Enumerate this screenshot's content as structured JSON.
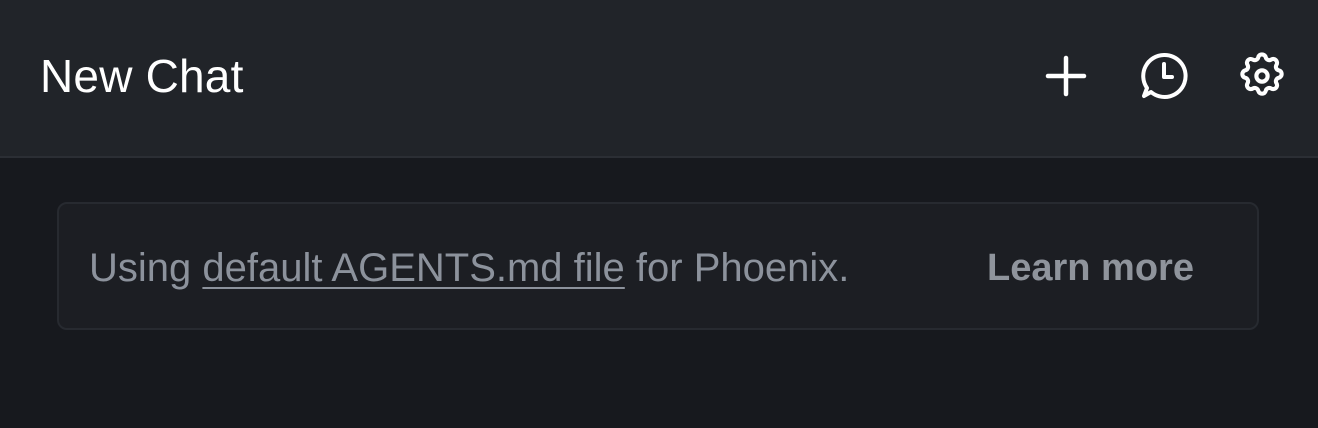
{
  "header": {
    "title": "New Chat",
    "actions": [
      {
        "icon": "plus-icon",
        "label": "New chat"
      },
      {
        "icon": "history-icon",
        "label": "History"
      },
      {
        "icon": "gear-icon",
        "label": "Settings"
      }
    ]
  },
  "notice": {
    "prefix": "Using ",
    "link": "default AGENTS.md file",
    "suffix": " for Phoenix.",
    "learn_more": "Learn more"
  },
  "colors": {
    "background": "#17191e",
    "header_background": "#212429",
    "notice_background": "#1c1e23",
    "title_text": "#ffffff",
    "muted_text": "#8c929c"
  }
}
